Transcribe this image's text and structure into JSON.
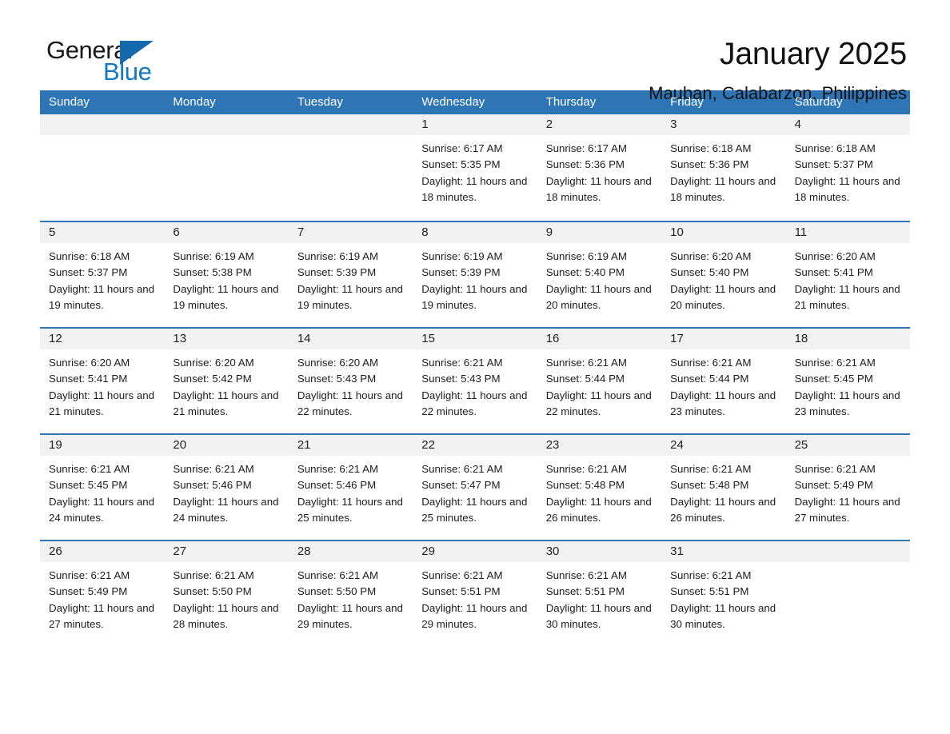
{
  "logo": {
    "word1": "General",
    "word2": "Blue",
    "triangle_color": "#1569ad",
    "blue_text_color": "#1178c4"
  },
  "header": {
    "title": "January 2025",
    "subtitle": "Mauban, Calabarzon, Philippines"
  },
  "theme": {
    "header_blue": "#2e75b6",
    "daynum_band": "#f2f2f2",
    "text": "#1c1c1c"
  },
  "weekdays": [
    "Sunday",
    "Monday",
    "Tuesday",
    "Wednesday",
    "Thursday",
    "Friday",
    "Saturday"
  ],
  "weeks": [
    [
      {
        "day": "",
        "sunrise": "",
        "sunset": "",
        "daylight": "",
        "empty": true
      },
      {
        "day": "",
        "sunrise": "",
        "sunset": "",
        "daylight": "",
        "empty": true
      },
      {
        "day": "",
        "sunrise": "",
        "sunset": "",
        "daylight": "",
        "empty": true
      },
      {
        "day": "1",
        "sunrise": "Sunrise: 6:17 AM",
        "sunset": "Sunset: 5:35 PM",
        "daylight": "Daylight: 11 hours and 18 minutes.",
        "empty": false
      },
      {
        "day": "2",
        "sunrise": "Sunrise: 6:17 AM",
        "sunset": "Sunset: 5:36 PM",
        "daylight": "Daylight: 11 hours and 18 minutes.",
        "empty": false
      },
      {
        "day": "3",
        "sunrise": "Sunrise: 6:18 AM",
        "sunset": "Sunset: 5:36 PM",
        "daylight": "Daylight: 11 hours and 18 minutes.",
        "empty": false
      },
      {
        "day": "4",
        "sunrise": "Sunrise: 6:18 AM",
        "sunset": "Sunset: 5:37 PM",
        "daylight": "Daylight: 11 hours and 18 minutes.",
        "empty": false
      }
    ],
    [
      {
        "day": "5",
        "sunrise": "Sunrise: 6:18 AM",
        "sunset": "Sunset: 5:37 PM",
        "daylight": "Daylight: 11 hours and 19 minutes.",
        "empty": false
      },
      {
        "day": "6",
        "sunrise": "Sunrise: 6:19 AM",
        "sunset": "Sunset: 5:38 PM",
        "daylight": "Daylight: 11 hours and 19 minutes.",
        "empty": false
      },
      {
        "day": "7",
        "sunrise": "Sunrise: 6:19 AM",
        "sunset": "Sunset: 5:39 PM",
        "daylight": "Daylight: 11 hours and 19 minutes.",
        "empty": false
      },
      {
        "day": "8",
        "sunrise": "Sunrise: 6:19 AM",
        "sunset": "Sunset: 5:39 PM",
        "daylight": "Daylight: 11 hours and 19 minutes.",
        "empty": false
      },
      {
        "day": "9",
        "sunrise": "Sunrise: 6:19 AM",
        "sunset": "Sunset: 5:40 PM",
        "daylight": "Daylight: 11 hours and 20 minutes.",
        "empty": false
      },
      {
        "day": "10",
        "sunrise": "Sunrise: 6:20 AM",
        "sunset": "Sunset: 5:40 PM",
        "daylight": "Daylight: 11 hours and 20 minutes.",
        "empty": false
      },
      {
        "day": "11",
        "sunrise": "Sunrise: 6:20 AM",
        "sunset": "Sunset: 5:41 PM",
        "daylight": "Daylight: 11 hours and 21 minutes.",
        "empty": false
      }
    ],
    [
      {
        "day": "12",
        "sunrise": "Sunrise: 6:20 AM",
        "sunset": "Sunset: 5:41 PM",
        "daylight": "Daylight: 11 hours and 21 minutes.",
        "empty": false
      },
      {
        "day": "13",
        "sunrise": "Sunrise: 6:20 AM",
        "sunset": "Sunset: 5:42 PM",
        "daylight": "Daylight: 11 hours and 21 minutes.",
        "empty": false
      },
      {
        "day": "14",
        "sunrise": "Sunrise: 6:20 AM",
        "sunset": "Sunset: 5:43 PM",
        "daylight": "Daylight: 11 hours and 22 minutes.",
        "empty": false
      },
      {
        "day": "15",
        "sunrise": "Sunrise: 6:21 AM",
        "sunset": "Sunset: 5:43 PM",
        "daylight": "Daylight: 11 hours and 22 minutes.",
        "empty": false
      },
      {
        "day": "16",
        "sunrise": "Sunrise: 6:21 AM",
        "sunset": "Sunset: 5:44 PM",
        "daylight": "Daylight: 11 hours and 22 minutes.",
        "empty": false
      },
      {
        "day": "17",
        "sunrise": "Sunrise: 6:21 AM",
        "sunset": "Sunset: 5:44 PM",
        "daylight": "Daylight: 11 hours and 23 minutes.",
        "empty": false
      },
      {
        "day": "18",
        "sunrise": "Sunrise: 6:21 AM",
        "sunset": "Sunset: 5:45 PM",
        "daylight": "Daylight: 11 hours and 23 minutes.",
        "empty": false
      }
    ],
    [
      {
        "day": "19",
        "sunrise": "Sunrise: 6:21 AM",
        "sunset": "Sunset: 5:45 PM",
        "daylight": "Daylight: 11 hours and 24 minutes.",
        "empty": false
      },
      {
        "day": "20",
        "sunrise": "Sunrise: 6:21 AM",
        "sunset": "Sunset: 5:46 PM",
        "daylight": "Daylight: 11 hours and 24 minutes.",
        "empty": false
      },
      {
        "day": "21",
        "sunrise": "Sunrise: 6:21 AM",
        "sunset": "Sunset: 5:46 PM",
        "daylight": "Daylight: 11 hours and 25 minutes.",
        "empty": false
      },
      {
        "day": "22",
        "sunrise": "Sunrise: 6:21 AM",
        "sunset": "Sunset: 5:47 PM",
        "daylight": "Daylight: 11 hours and 25 minutes.",
        "empty": false
      },
      {
        "day": "23",
        "sunrise": "Sunrise: 6:21 AM",
        "sunset": "Sunset: 5:48 PM",
        "daylight": "Daylight: 11 hours and 26 minutes.",
        "empty": false
      },
      {
        "day": "24",
        "sunrise": "Sunrise: 6:21 AM",
        "sunset": "Sunset: 5:48 PM",
        "daylight": "Daylight: 11 hours and 26 minutes.",
        "empty": false
      },
      {
        "day": "25",
        "sunrise": "Sunrise: 6:21 AM",
        "sunset": "Sunset: 5:49 PM",
        "daylight": "Daylight: 11 hours and 27 minutes.",
        "empty": false
      }
    ],
    [
      {
        "day": "26",
        "sunrise": "Sunrise: 6:21 AM",
        "sunset": "Sunset: 5:49 PM",
        "daylight": "Daylight: 11 hours and 27 minutes.",
        "empty": false
      },
      {
        "day": "27",
        "sunrise": "Sunrise: 6:21 AM",
        "sunset": "Sunset: 5:50 PM",
        "daylight": "Daylight: 11 hours and 28 minutes.",
        "empty": false
      },
      {
        "day": "28",
        "sunrise": "Sunrise: 6:21 AM",
        "sunset": "Sunset: 5:50 PM",
        "daylight": "Daylight: 11 hours and 29 minutes.",
        "empty": false
      },
      {
        "day": "29",
        "sunrise": "Sunrise: 6:21 AM",
        "sunset": "Sunset: 5:51 PM",
        "daylight": "Daylight: 11 hours and 29 minutes.",
        "empty": false
      },
      {
        "day": "30",
        "sunrise": "Sunrise: 6:21 AM",
        "sunset": "Sunset: 5:51 PM",
        "daylight": "Daylight: 11 hours and 30 minutes.",
        "empty": false
      },
      {
        "day": "31",
        "sunrise": "Sunrise: 6:21 AM",
        "sunset": "Sunset: 5:51 PM",
        "daylight": "Daylight: 11 hours and 30 minutes.",
        "empty": false
      },
      {
        "day": "",
        "sunrise": "",
        "sunset": "",
        "daylight": "",
        "empty": true
      }
    ]
  ]
}
